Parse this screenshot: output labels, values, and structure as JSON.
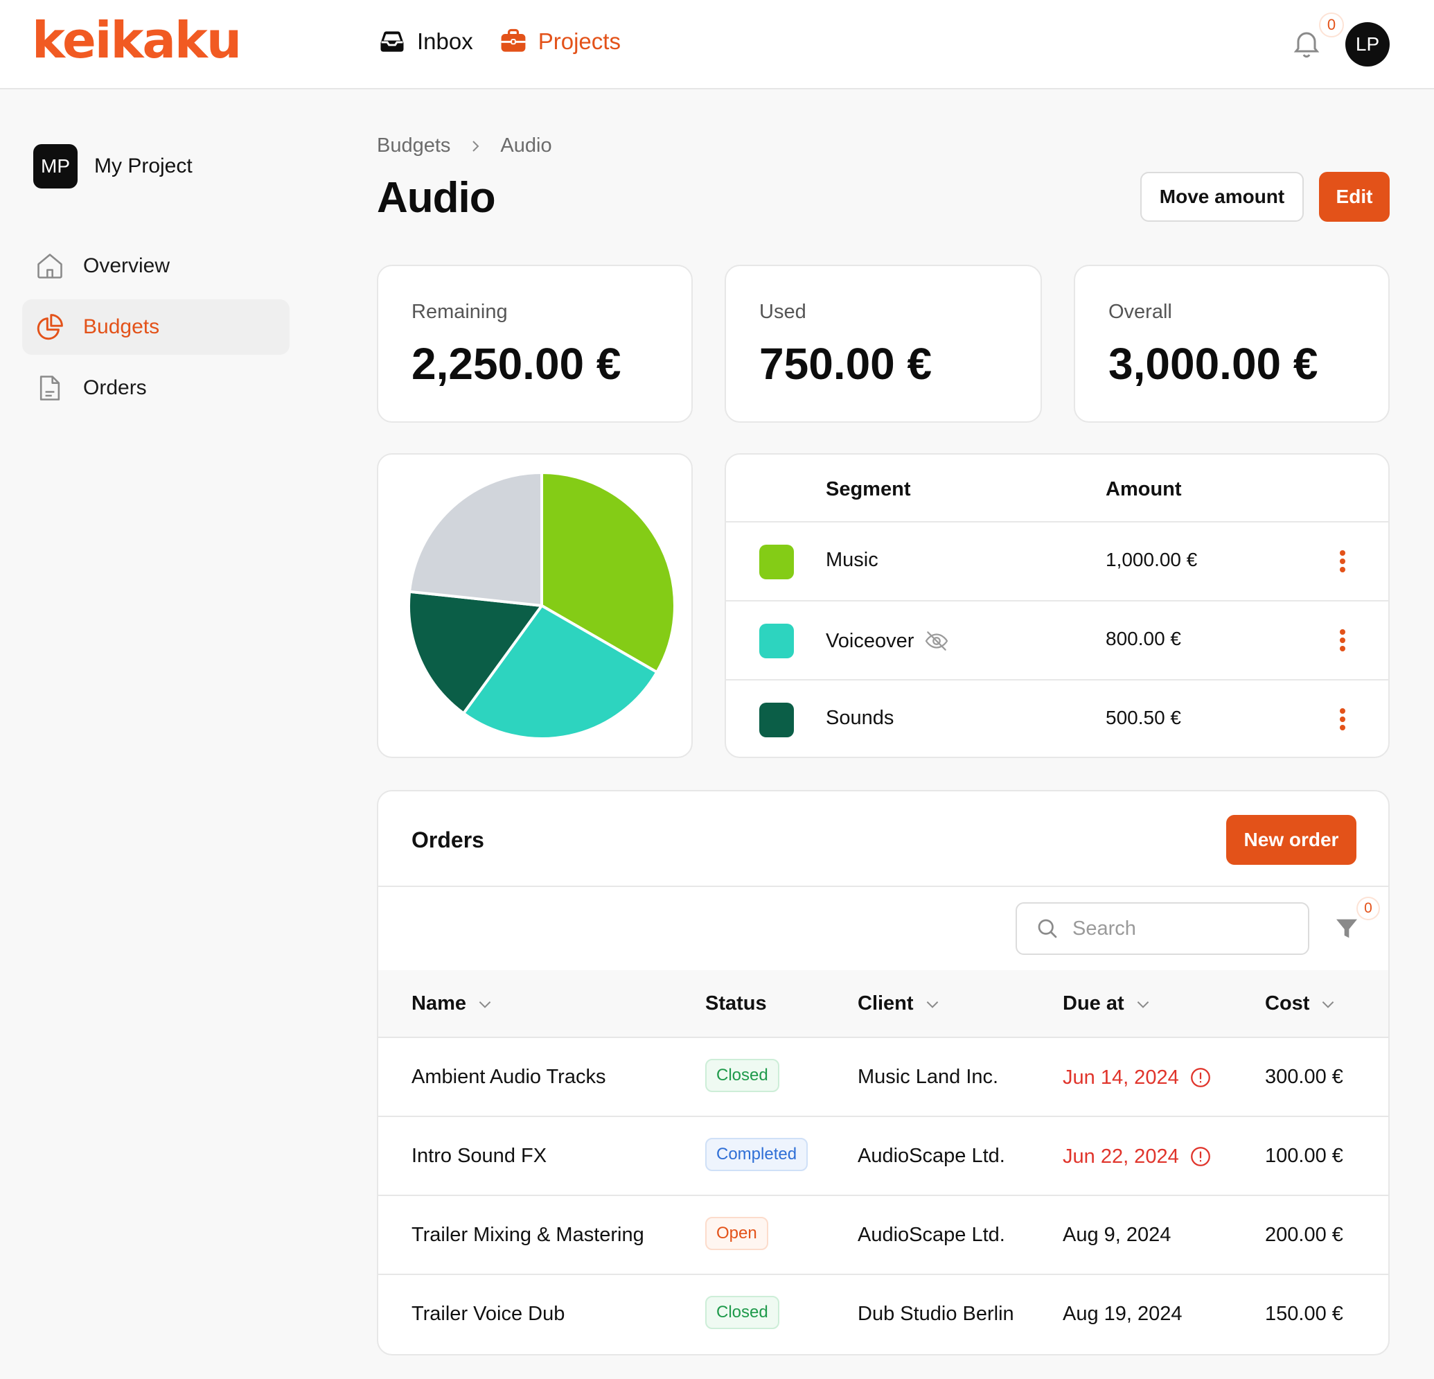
{
  "app": {
    "logo": "keikaku"
  },
  "topnav": {
    "inbox_label": "Inbox",
    "projects_label": "Projects",
    "notification_count": "0",
    "user_initials": "LP"
  },
  "sidebar": {
    "project_initials": "MP",
    "project_name": "My Project",
    "items": [
      {
        "label": "Overview",
        "icon": "home-icon"
      },
      {
        "label": "Budgets",
        "icon": "pie-chart-icon",
        "active": true
      },
      {
        "label": "Orders",
        "icon": "document-icon"
      }
    ]
  },
  "header": {
    "breadcrumb": [
      "Budgets",
      "Audio"
    ],
    "title": "Audio",
    "move_amount_label": "Move amount",
    "edit_label": "Edit"
  },
  "stats": [
    {
      "label": "Remaining",
      "value": "2,250.00 €"
    },
    {
      "label": "Used",
      "value": "750.00 €"
    },
    {
      "label": "Overall",
      "value": "3,000.00 €"
    }
  ],
  "segments": {
    "headers": {
      "segment": "Segment",
      "amount": "Amount"
    },
    "rows": [
      {
        "name": "Music",
        "amount": "1,000.00 €",
        "color": "#84cc16",
        "hidden": false
      },
      {
        "name": "Voiceover",
        "amount": "800.00 €",
        "color": "#2dd4bf",
        "hidden": true
      },
      {
        "name": "Sounds",
        "amount": "500.50 €",
        "color": "#0b5e47",
        "hidden": false
      }
    ]
  },
  "chart_data": {
    "type": "pie",
    "slices": [
      {
        "label": "Music",
        "value": 1000.0,
        "color": "#84cc16"
      },
      {
        "label": "Voiceover",
        "value": 800.0,
        "color": "#2dd4bf"
      },
      {
        "label": "Sounds",
        "value": 500.5,
        "color": "#0b5e47"
      },
      {
        "label": "",
        "value": 699.5,
        "color": "#d1d5db"
      }
    ]
  },
  "orders": {
    "title": "Orders",
    "new_order_label": "New order",
    "search_placeholder": "Search",
    "filter_count": "0",
    "columns": {
      "name": "Name",
      "status": "Status",
      "client": "Client",
      "due": "Due at",
      "cost": "Cost"
    },
    "rows": [
      {
        "name": "Ambient Audio Tracks",
        "status": "Closed",
        "status_kind": "closed",
        "client": "Music Land Inc.",
        "due": "Jun 14, 2024",
        "overdue": true,
        "cost": "300.00 €"
      },
      {
        "name": "Intro Sound FX",
        "status": "Completed",
        "status_kind": "completed",
        "client": "AudioScape Ltd.",
        "due": "Jun 22, 2024",
        "overdue": true,
        "cost": "100.00 €"
      },
      {
        "name": "Trailer Mixing & Mastering",
        "status": "Open",
        "status_kind": "open",
        "client": "AudioScape Ltd.",
        "due": "Aug 9, 2024",
        "overdue": false,
        "cost": "200.00 €"
      },
      {
        "name": "Trailer Voice Dub",
        "status": "Closed",
        "status_kind": "closed",
        "client": "Dub Studio Berlin",
        "due": "Aug 19, 2024",
        "overdue": false,
        "cost": "150.00 €"
      }
    ]
  },
  "colors": {
    "accent": "#e35219",
    "overdue": "#e0342b"
  }
}
